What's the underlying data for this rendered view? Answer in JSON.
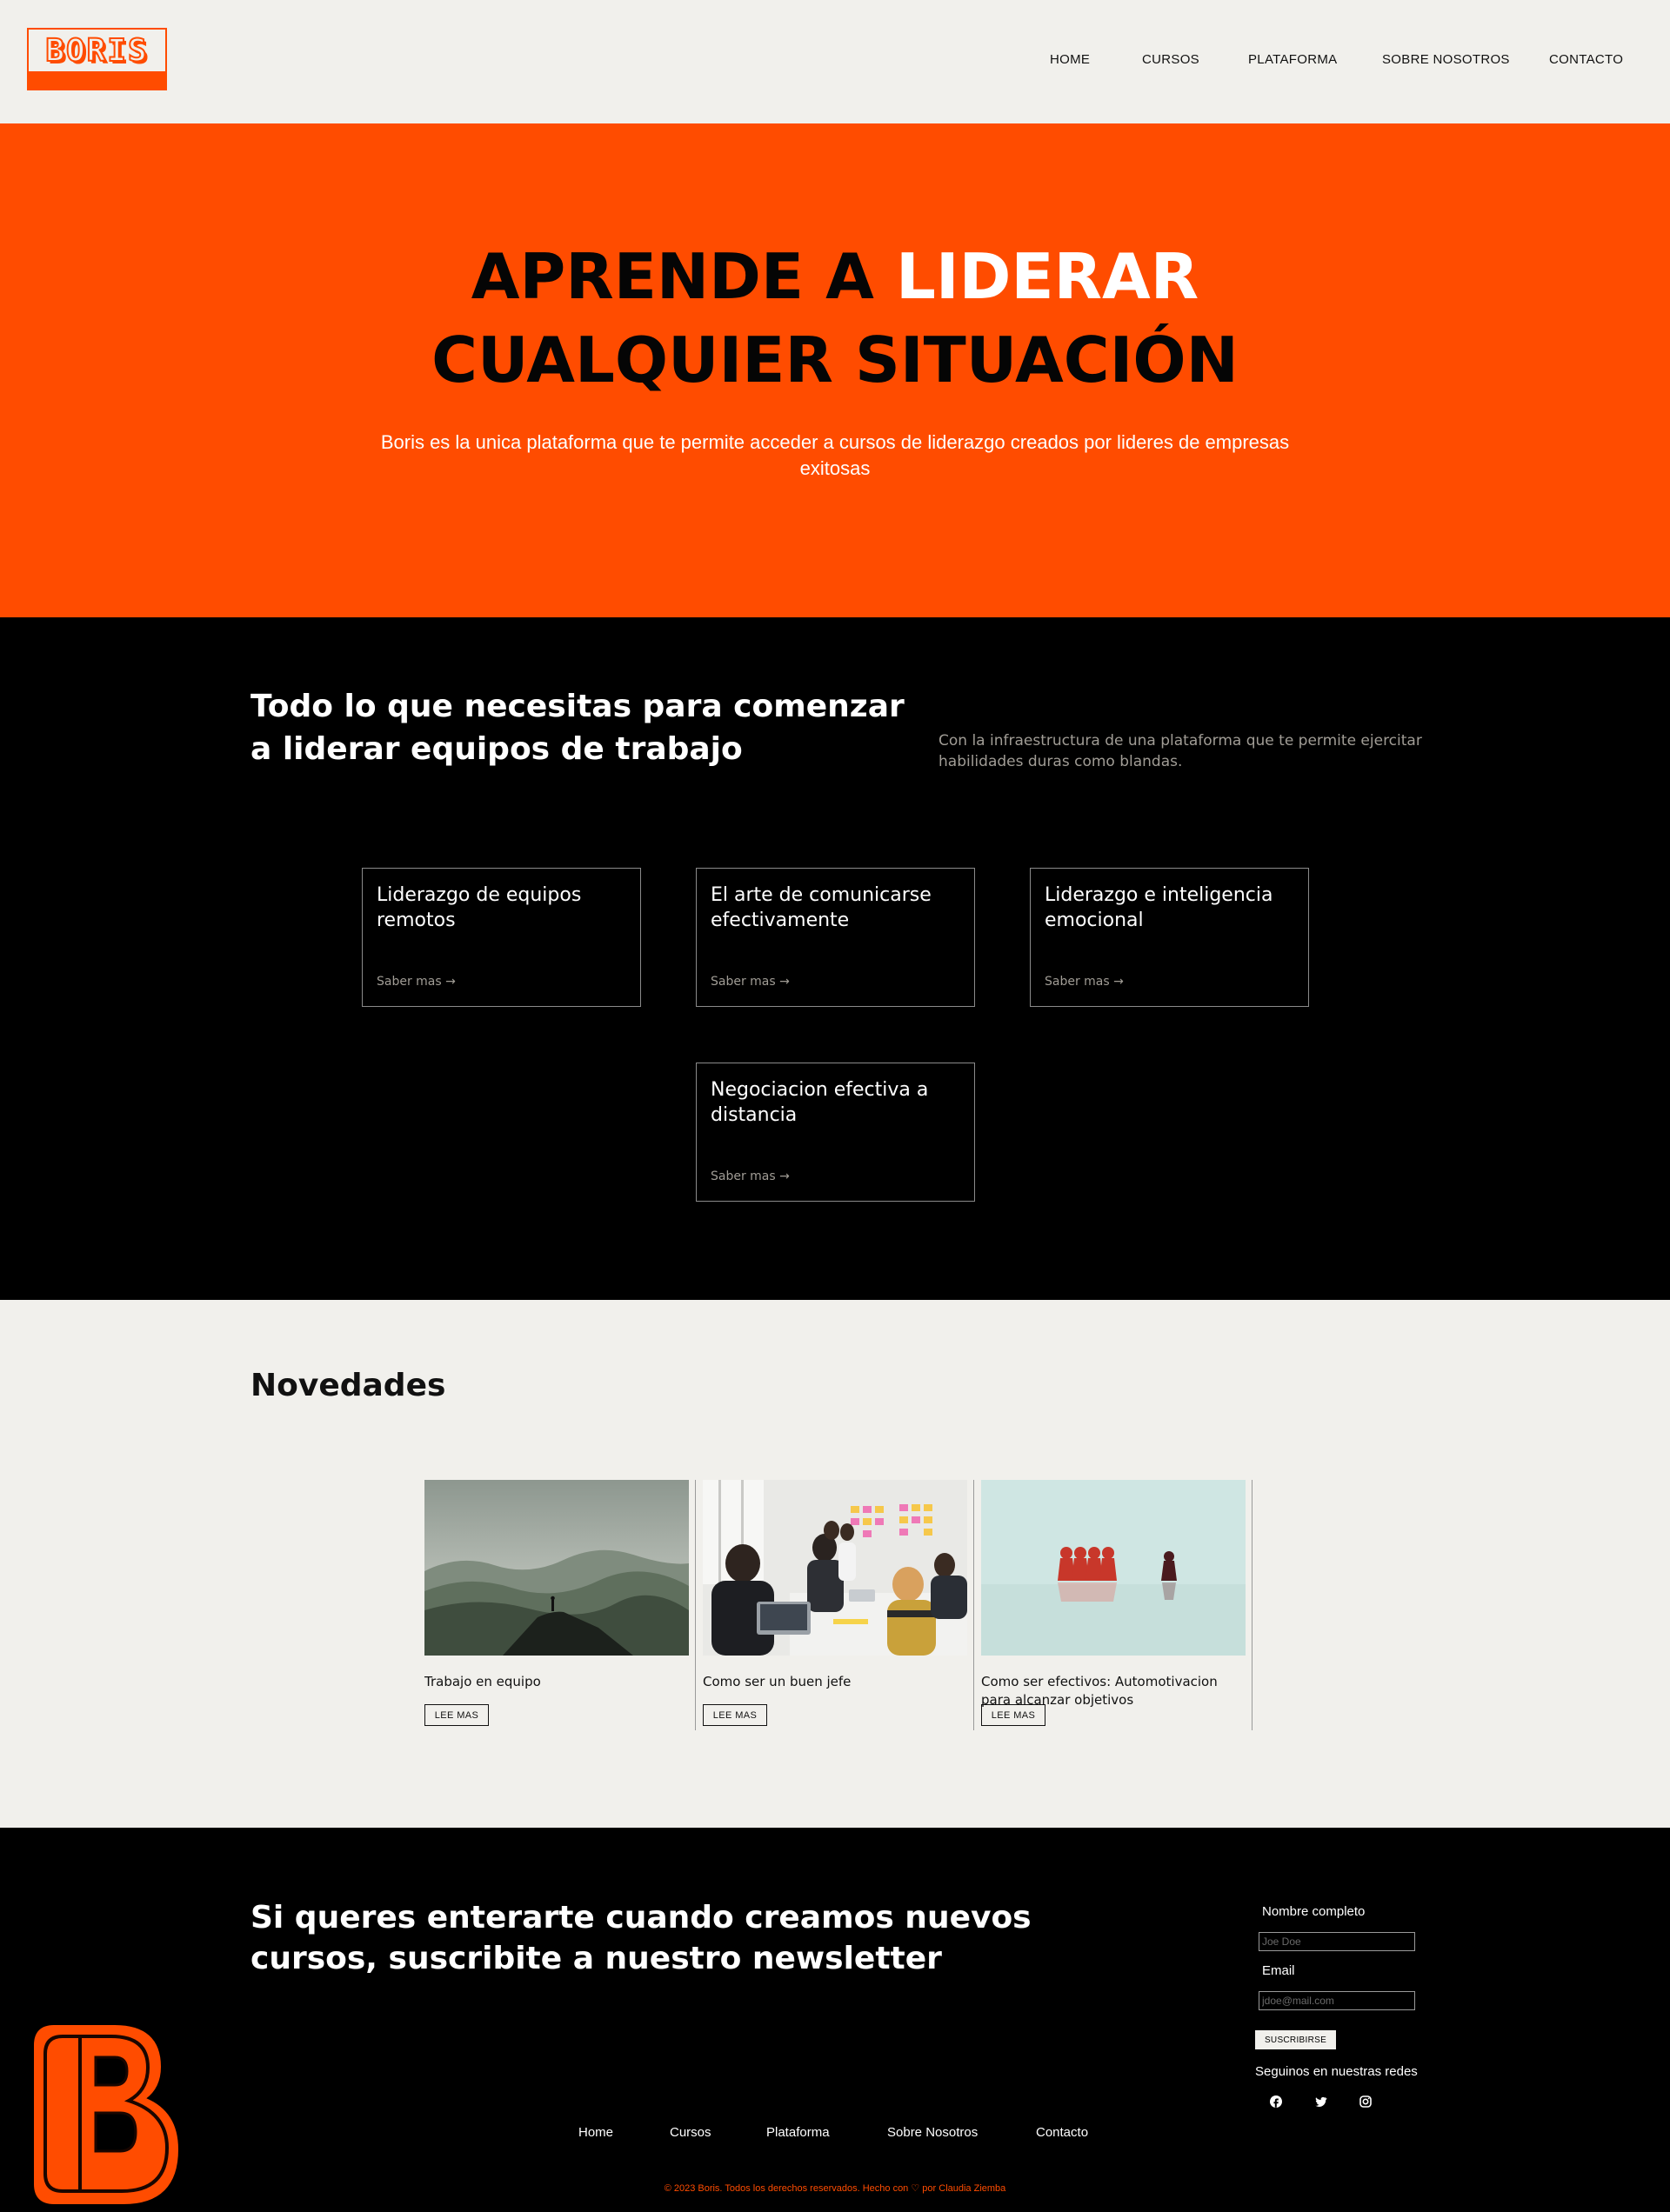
{
  "brand": {
    "logo_text": "BORIS",
    "accent": "#ff4c00",
    "cream": "#f1f0ec"
  },
  "nav": [
    "HOME",
    "CURSOS",
    "PLATAFORMA",
    "SOBRE NOSOTROS",
    "CONTACTO"
  ],
  "hero": {
    "title_before": "APRENDE A ",
    "title_highlight": "LIDERAR",
    "title_after": " CUALQUIER SITUACIÓN",
    "subtitle": "Boris es la unica plataforma que te permite acceder a cursos de liderazgo creados por lideres de empresas exitosas"
  },
  "features": {
    "title": "Todo lo que necesitas para comenzar a liderar equipos de trabajo",
    "description": "Con la infraestructura de una plataforma que te permite ejercitar habilidades duras como blandas.",
    "link_label": "Saber mas →",
    "cards": [
      {
        "title": "Liderazgo de equipos remotos"
      },
      {
        "title": "El arte de comunicarse efectivamente"
      },
      {
        "title": "Liderazgo e inteligencia emocional"
      },
      {
        "title": "Negociacion efectiva a distancia"
      }
    ]
  },
  "news": {
    "title": "Novedades",
    "button_label": "LEE MAS",
    "items": [
      {
        "caption": "Trabajo en equipo",
        "image": "mountain-landscape"
      },
      {
        "caption": "Como ser un buen jefe",
        "image": "office-meeting"
      },
      {
        "caption": "Como ser efectivos: Automotivacion para alcanzar objetivos",
        "image": "game-pieces"
      }
    ]
  },
  "newsletter": {
    "title": "Si queres enterarte cuando creamos nuevos cursos, suscribite a nuestro newsletter",
    "name_label": "Nombre completo",
    "name_placeholder": "Joe Doe",
    "email_label": "Email",
    "email_placeholder": "jdoe@mail.com",
    "submit_label": "SUSCRIBIRSE",
    "social_title": "Seguinos en nuestras redes",
    "social_icons": [
      "facebook-icon",
      "twitter-icon",
      "instagram-icon"
    ]
  },
  "footer": {
    "links": [
      "Home",
      "Cursos",
      "Plataforma",
      "Sobre Nosotros",
      "Contacto"
    ],
    "copyright_before": "© 2023 Boris. Todos los derechos reservados. Hecho con ",
    "copyright_after": " por Claudia Ziemba"
  }
}
